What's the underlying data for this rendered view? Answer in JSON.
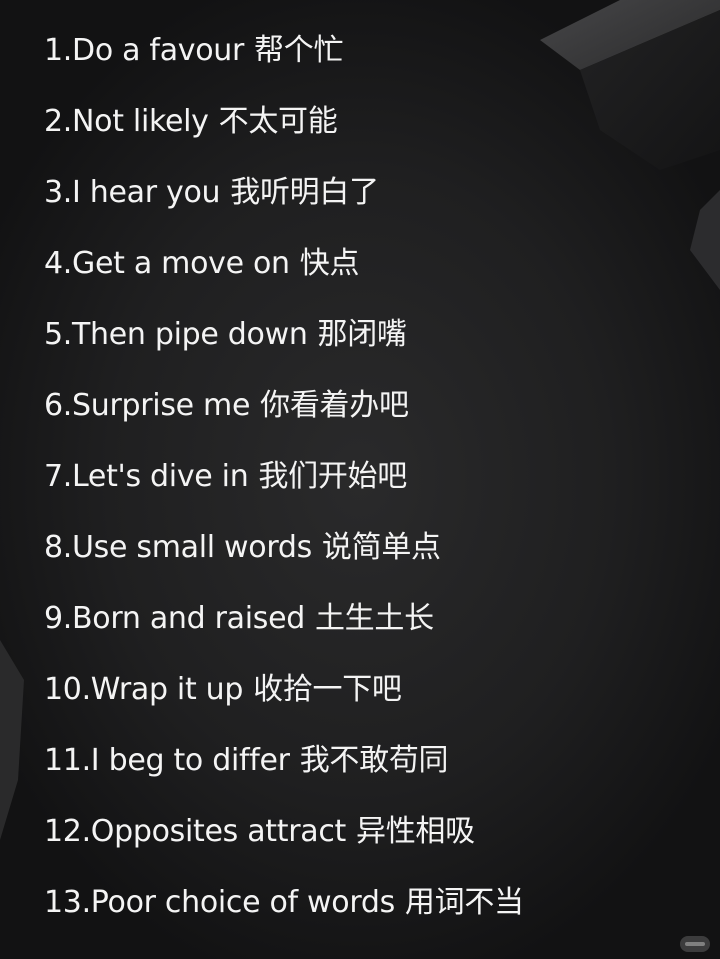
{
  "phrases": [
    {
      "en": "1.Do a favour",
      "zh": "帮个忙"
    },
    {
      "en": "2.Not likely",
      "zh": "不太可能"
    },
    {
      "en": "3.I hear you",
      "zh": "我听明白了"
    },
    {
      "en": "4.Get a move on",
      "zh": "快点"
    },
    {
      "en": "5.Then pipe down",
      "zh": "那闭嘴"
    },
    {
      "en": "6.Surprise me",
      "zh": "你看着办吧"
    },
    {
      "en": "7.Let's dive in",
      "zh": "我们开始吧"
    },
    {
      "en": "8.Use small words",
      "zh": "说简单点"
    },
    {
      "en": "9.Born and raised",
      "zh": "土生土长"
    },
    {
      "en": "10.Wrap it up",
      "zh": "收拾一下吧"
    },
    {
      "en": "11.I beg to differ",
      "zh": "我不敢苟同"
    },
    {
      "en": "12.Opposites attract",
      "zh": "异性相吸"
    },
    {
      "en": "13.Poor choice of words",
      "zh": "用词不当"
    }
  ],
  "colors": {
    "background": "#1c1c1d",
    "text": "#f4f4f4"
  }
}
